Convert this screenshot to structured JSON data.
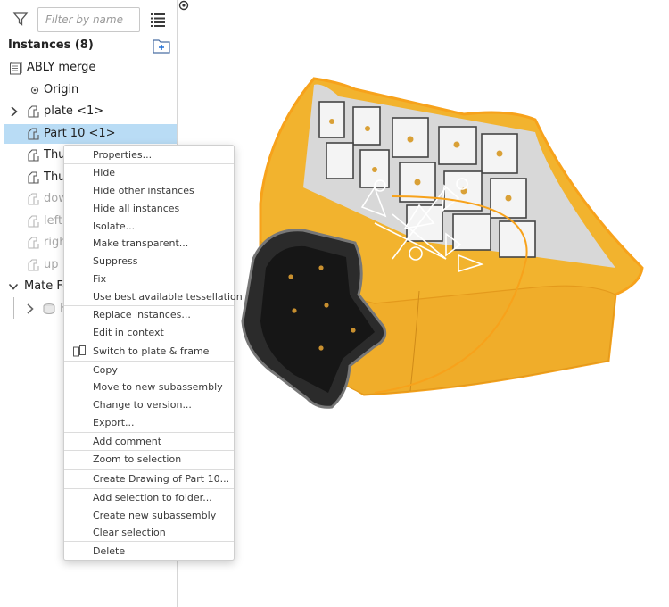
{
  "panel": {
    "filter_placeholder": "Filter by name",
    "instances_header": "Instances (8)",
    "tree": [
      {
        "label": "ABLY merge",
        "icon": "assembly-icon"
      },
      {
        "label": "Origin",
        "icon": "origin-icon"
      },
      {
        "label": "plate <1>",
        "icon": "part-icon",
        "expandable": true
      },
      {
        "label": "Part 10 <1>",
        "icon": "part-icon",
        "selected": true
      },
      {
        "label": "Thu",
        "icon": "part-icon"
      },
      {
        "label": "Thu",
        "icon": "part-icon"
      },
      {
        "label": "dow",
        "icon": "part-icon",
        "hidden": true
      },
      {
        "label": "left",
        "icon": "part-icon",
        "hidden": true
      },
      {
        "label": "right",
        "icon": "part-icon",
        "hidden": true
      },
      {
        "label": "up <",
        "icon": "part-icon",
        "hidden": true
      },
      {
        "label": "Mate Fe",
        "icon": "chevron-down-icon"
      },
      {
        "label": "F",
        "icon": "mate-icon",
        "hidden": true
      }
    ]
  },
  "context_menu": {
    "items": [
      "Properties...",
      "Hide",
      "Hide other instances",
      "Hide all instances",
      "Isolate...",
      "Make transparent...",
      "Suppress",
      "Fix",
      "Use best available tessellation",
      "Replace instances...",
      "Edit in context",
      "Switch to plate & frame",
      "Copy",
      "Move to new subassembly",
      "Change to version...",
      "Export...",
      "Add comment",
      "Zoom to selection",
      "Create Drawing of Part 10...",
      "Add selection to folder...",
      "Create new subassembly",
      "Clear selection",
      "Delete"
    ]
  },
  "viewport": {
    "selection_color": "#f2b32e",
    "highlight_edge_color": "#f7a21b"
  }
}
